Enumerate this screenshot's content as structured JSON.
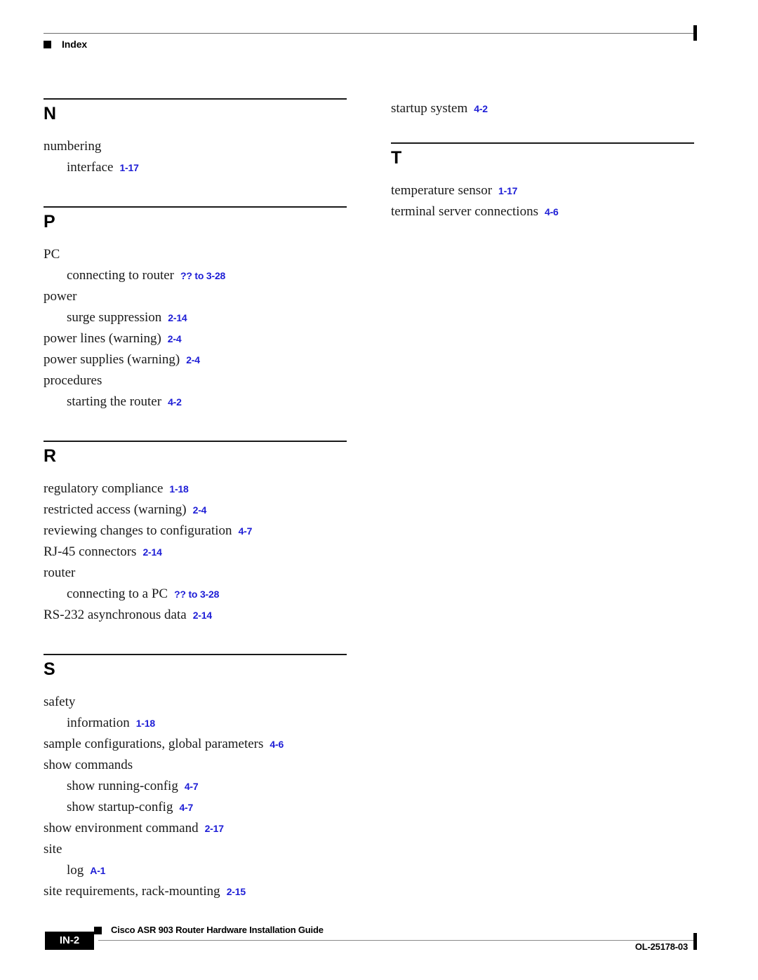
{
  "header": {
    "title": "Index",
    "bullet_icon": "black-square-icon"
  },
  "colors": {
    "page_reference": "#1d1dd6",
    "text": "#1a1a1a",
    "rule": "#1a1a1a",
    "footer_box": "#000000"
  },
  "columns": {
    "left": {
      "orphan_entries": [],
      "sections": [
        {
          "letter": "N",
          "entries": [
            {
              "term": "numbering",
              "pages": "",
              "level": 1
            },
            {
              "term": "interface",
              "pages": "1-17",
              "level": 2
            }
          ]
        },
        {
          "letter": "P",
          "entries": [
            {
              "term": "PC",
              "pages": "",
              "level": 1
            },
            {
              "term": "connecting to router",
              "pages": "?? to 3-28",
              "level": 2
            },
            {
              "term": "power",
              "pages": "",
              "level": 1
            },
            {
              "term": "surge suppression",
              "pages": "2-14",
              "level": 2
            },
            {
              "term": "power lines (warning)",
              "pages": "2-4",
              "level": 1
            },
            {
              "term": "power supplies (warning)",
              "pages": "2-4",
              "level": 1
            },
            {
              "term": "procedures",
              "pages": "",
              "level": 1
            },
            {
              "term": "starting the router",
              "pages": "4-2",
              "level": 2
            }
          ]
        },
        {
          "letter": "R",
          "entries": [
            {
              "term": "regulatory compliance",
              "pages": "1-18",
              "level": 1
            },
            {
              "term": "restricted access (warning)",
              "pages": "2-4",
              "level": 1
            },
            {
              "term": "reviewing changes to configuration",
              "pages": "4-7",
              "level": 1
            },
            {
              "term": "RJ-45 connectors",
              "pages": "2-14",
              "level": 1
            },
            {
              "term": "router",
              "pages": "",
              "level": 1
            },
            {
              "term": "connecting to a PC",
              "pages": "?? to 3-28",
              "level": 2
            },
            {
              "term": "RS-232 asynchronous data",
              "pages": "2-14",
              "level": 1
            }
          ]
        },
        {
          "letter": "S",
          "entries": [
            {
              "term": "safety",
              "pages": "",
              "level": 1
            },
            {
              "term": "information",
              "pages": "1-18",
              "level": 2
            },
            {
              "term": "sample configurations, global parameters",
              "pages": "4-6",
              "level": 1
            },
            {
              "term": "show commands",
              "pages": "",
              "level": 1
            },
            {
              "term": "show running-config",
              "pages": "4-7",
              "level": 2
            },
            {
              "term": "show startup-config",
              "pages": "4-7",
              "level": 2
            },
            {
              "term": "show environment command",
              "pages": "2-17",
              "level": 1
            },
            {
              "term": "site",
              "pages": "",
              "level": 1
            },
            {
              "term": "log",
              "pages": "A-1",
              "level": 2
            },
            {
              "term": "site requirements, rack-mounting",
              "pages": "2-15",
              "level": 1
            }
          ]
        }
      ]
    },
    "right": {
      "orphan_entries": [
        {
          "term": "startup system",
          "pages": "4-2",
          "level": 1
        }
      ],
      "sections": [
        {
          "letter": "T",
          "entries": [
            {
              "term": "temperature sensor",
              "pages": "1-17",
              "level": 1
            },
            {
              "term": "terminal server connections",
              "pages": "4-6",
              "level": 1
            }
          ]
        }
      ]
    }
  },
  "footer": {
    "page_number": "IN-2",
    "guide_title": "Cisco ASR 903 Router Hardware Installation Guide",
    "doc_id": "OL-25178-03",
    "bullet_icon": "black-square-icon"
  }
}
